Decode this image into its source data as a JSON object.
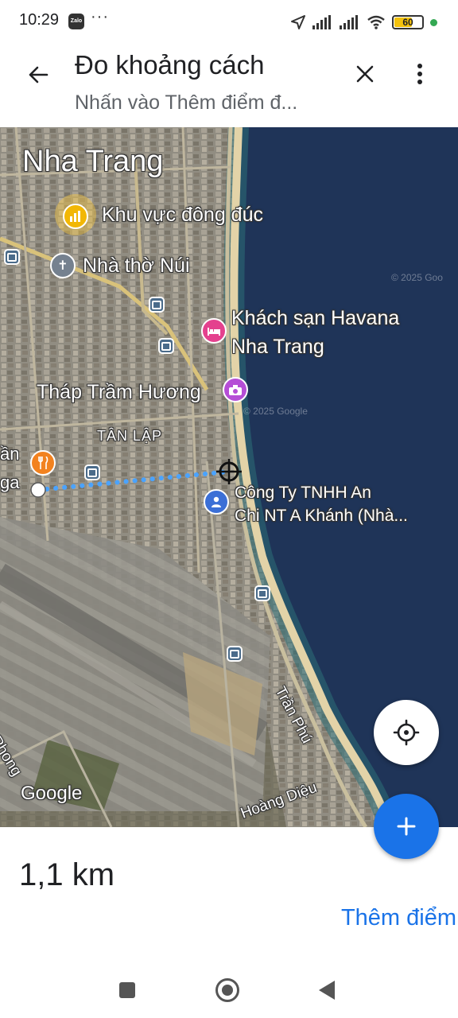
{
  "status_bar": {
    "time": "10:29",
    "app_badge": "Zalo",
    "more": "···",
    "battery": "60"
  },
  "header": {
    "title": "Đo khoảng cách",
    "subtitle": "Nhấn vào Thêm điểm đ..."
  },
  "map": {
    "city_label": "Nha Trang",
    "places": {
      "crowded_area": "Khu vực đông đúc",
      "church": "Nhà thờ Núi",
      "hotel_line1": "Khách sạn Havana",
      "hotel_line2": "Nha Trang",
      "tower": "Tháp Trầm Hương",
      "district": "TÂN LẬP",
      "company_line1": "Công Ty TNHH An",
      "company_line2": "Chi NT A Khánh (Nhà...",
      "left_partial_1": "ần",
      "left_partial_2": "ga"
    },
    "streets": {
      "tran_phu": "Trần Phú",
      "hoang_dieu": "Hoàng Diệu",
      "phong": "Phong"
    },
    "attribution": "Google",
    "copyright": "© 2025 Goo",
    "watermark": "© 2025 Google"
  },
  "measurement": {
    "distance": "1,1 km",
    "add_point_label": "Thêm điểm"
  },
  "colors": {
    "accent": "#1a73e8",
    "sea": "#1f3458",
    "beach": "#e3d3a8"
  },
  "icons": {
    "back": "arrow-left-icon",
    "close": "close-icon",
    "menu": "more-vert-icon",
    "locate": "my-location-icon",
    "add": "plus-icon"
  }
}
